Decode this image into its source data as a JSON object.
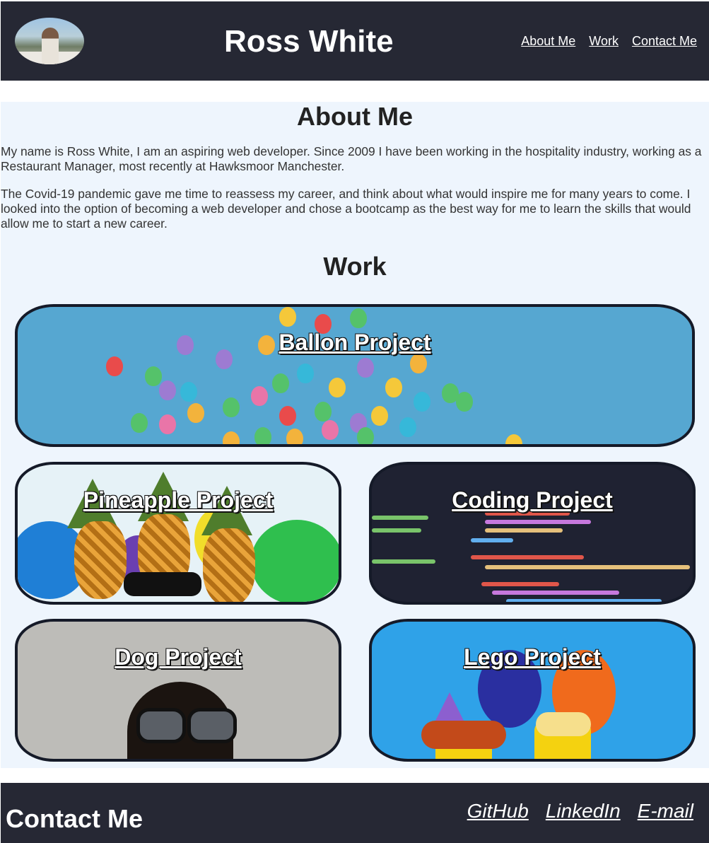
{
  "header": {
    "name": "Ross White",
    "nav": [
      "About Me",
      "Work",
      "Contact Me"
    ]
  },
  "about": {
    "title": "About Me",
    "paragraphs": [
      "My name is Ross White, I am an aspiring web developer. Since 2009 I have been working in the hospitality industry, working as a Restaurant Manager, most recently at Hawksmoor Manchester.",
      "The Covid-19 pandemic gave me time to reassess my career, and think about what would inspire me for many years to come. I looked into the option of becoming a web developer and chose a bootcamp as the best way for me to learn the skills that would allow me to start a new career."
    ]
  },
  "work": {
    "title": "Work",
    "projects": [
      "Ballon Project",
      "Pineapple Project",
      "Coding Project",
      "Dog Project",
      "Lego Project"
    ]
  },
  "footer": {
    "title": "Contact Me",
    "links": [
      "GitHub",
      "LinkedIn",
      "E-mail"
    ]
  },
  "colors": {
    "header_bg": "#262834",
    "main_bg": "#eef5fd",
    "card_border": "#151a28"
  },
  "icons": [
    "profile-photo"
  ]
}
